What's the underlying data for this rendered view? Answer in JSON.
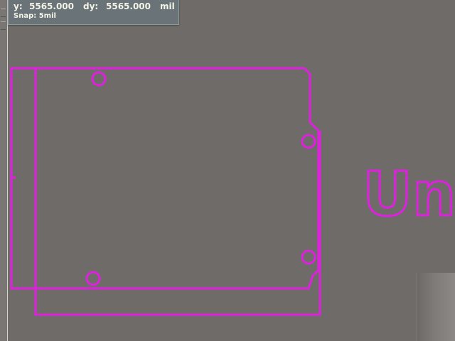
{
  "status_panel": {
    "y_label": "y:",
    "y_value": "5565.000",
    "dy_label": "dy:",
    "dy_value": "5565.000",
    "unit": "mil",
    "snap": "Snap: 5mil"
  },
  "board": {
    "text": "Un",
    "outline_color": "#e020e0",
    "background_color": "#6f6b68"
  }
}
